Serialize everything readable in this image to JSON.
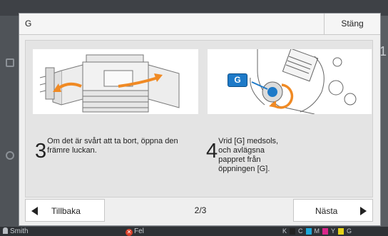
{
  "dialog": {
    "title": "G",
    "close_label": "Stäng"
  },
  "steps": [
    {
      "number": "3",
      "text": "Om det är svårt att ta bort, öppna den främre luckan.",
      "image_icon": "printer-open-doors-illustration"
    },
    {
      "number": "4",
      "text": "Vrid [G] medsols, och avlägsna pappret från öppningen [G].",
      "image_icon": "knob-g-rotate-illustration",
      "badge_label": "G"
    }
  ],
  "footer": {
    "back_label": "Tillbaka",
    "next_label": "Nästa",
    "page_indicator": "2/3"
  },
  "background": {
    "status_user": "Smith",
    "status_error": "Fel",
    "toner_labels": [
      "K",
      "C",
      "M",
      "Y",
      "G"
    ],
    "right_digit": "1"
  },
  "colors": {
    "accent_blue": "#1e7ac8",
    "arrow_orange": "#f08a24",
    "error_red": "#d9412b"
  }
}
